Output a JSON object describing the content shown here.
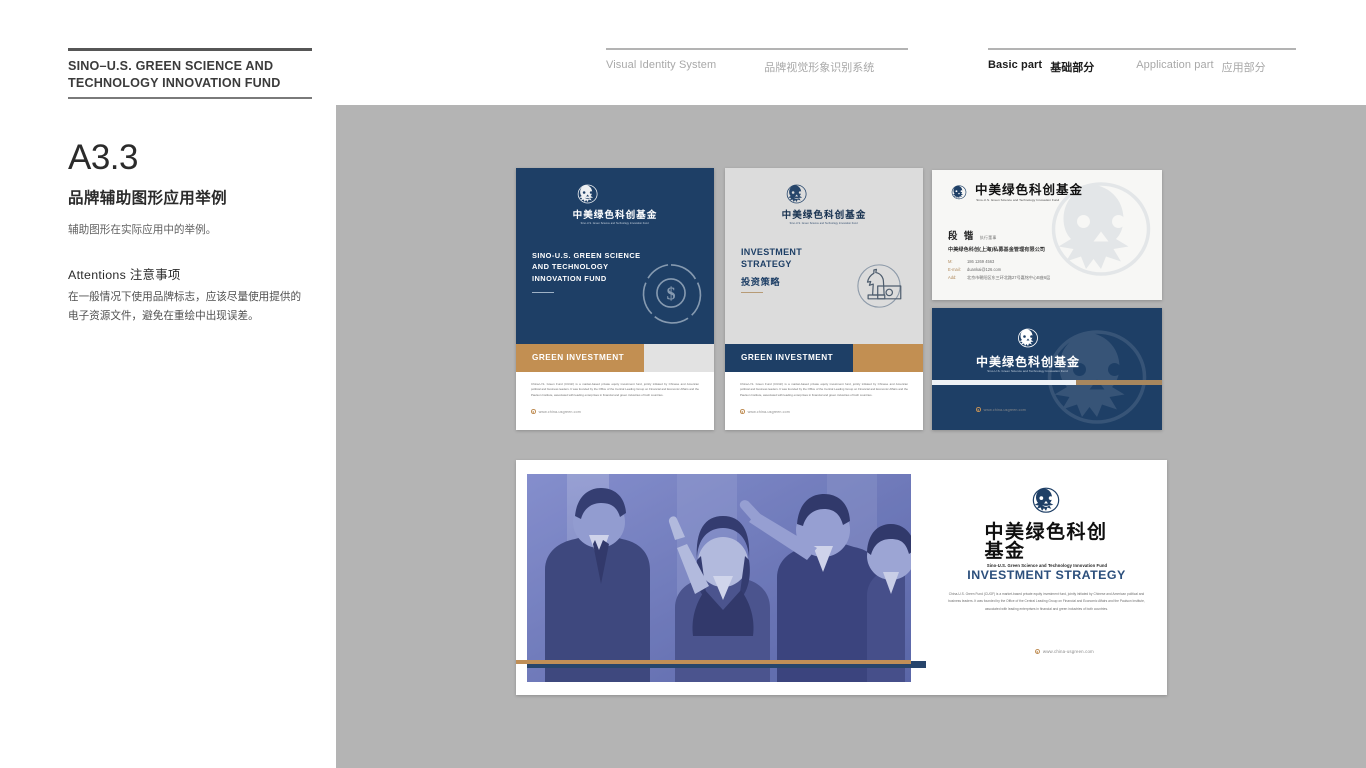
{
  "header": {
    "brand_name": "SINO–U.S. GREEN SCIENCE AND TECHNOLOGY INNOVATION FUND",
    "nav_left": {
      "en": "Visual Identity System",
      "cn": "品牌视觉形象识别系统"
    },
    "nav_right": {
      "basic_en": "Basic part",
      "basic_cn": "基础部分",
      "app_en": "Application part",
      "app_cn": "应用部分"
    }
  },
  "sidebar": {
    "section_code": "A3.3",
    "section_title": "品牌辅助图形应用举例",
    "section_desc": "辅助图形在实际应用中的举例。",
    "attentions_title": "Attentions 注意事项",
    "attentions_body": "在一般情况下使用品牌标志，应该尽量使用提供的电子资源文件，避免在重绘中出现误差。"
  },
  "logo": {
    "cn": "中美绿色科创基金",
    "en": "Sino-U.S. Green Science and Technology Innovation Fund"
  },
  "brochure_navy": {
    "headline": "SINO-U.S. GREEN SCIENCE AND TECHNOLOGY INNOVATION FUND",
    "band_label": "GREEN INVESTMENT",
    "body": "China-U.S. Green Fund (CUGF) is a market-based private equity investment fund, jointly initiated by Chinese and American political and business leaders. It was founded by the Office of the Central Leading Group on Financial and Economic Affairs and the Paulson Institute, associated with leading enterprises in financial and green industries of both countries.",
    "url": "www.china-usgreen.com",
    "graphic": "donut-dollar-icon"
  },
  "brochure_light": {
    "headline_en": "INVESTMENT STRATEGY",
    "headline_cn": "投资策略",
    "band_label": "GREEN INVESTMENT",
    "body": "China-U.S. Green Fund (CUGF) is a market-based private equity investment fund, jointly initiated by Chinese and American political and business leaders. It was founded by the Office of the Central Leading Group on Financial and Economic Affairs and the Paulson Institute, associated with leading enterprises in financial and green industries of both countries.",
    "url": "www.china-usgreen.com",
    "graphic": "knight-chess-banknote-icon"
  },
  "business_card": {
    "name": "段 锴",
    "title": "执行董事",
    "company": "中美绿色科创(上海)私募基金管理有限公司",
    "contacts": [
      {
        "key": "M:",
        "value": "186 1269 4563"
      },
      {
        "key": "E-mail:",
        "value": "duankai@126.com"
      },
      {
        "key": "Add:",
        "value": "北京市朝阳区东三环北路27号嘉铭中心B座6层"
      }
    ]
  },
  "navy_card": {
    "url": "www.china-usgreen.com"
  },
  "banner": {
    "headline": "INVESTMENT STRATEGY",
    "paragraph": "China-U.S. Green Fund (CUGF) is a market-based private equity investment fund, jointly initiated by Chinese and American political and business leaders. It was founded by the Office of the Central Leading Group on Financial and Economic Affairs and the Paulson Institute, associated with leading enterprises in financial and green industries of both countries.",
    "url": "www.china-usgreen.com",
    "photo_alt": "business-team-high-five-photo"
  },
  "colors": {
    "navy": "#1e3f66",
    "tan": "#c28f52",
    "canvas_gray": "#b4b4b4",
    "light_gray": "#dcdcdc"
  }
}
